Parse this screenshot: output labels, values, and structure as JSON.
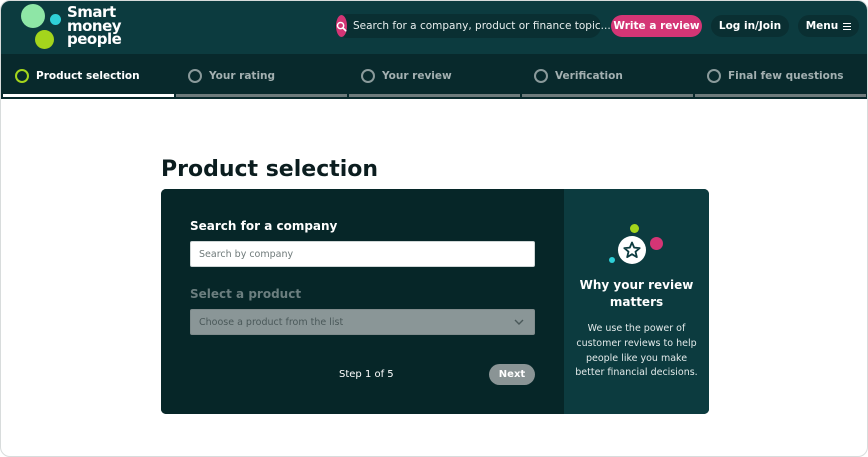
{
  "brand": {
    "logo_lines": [
      "Smart",
      "money",
      "people"
    ],
    "colors": {
      "header_bg": "#0c3b3f",
      "accent_pink": "#d43575",
      "accent_lime": "#a4d51c",
      "accent_mint": "#8ee6a6",
      "accent_cyan": "#2fd0d8",
      "card_bg": "#062628"
    }
  },
  "header": {
    "search_placeholder": "Search for a company, product or finance topic...",
    "search_icon": "search-icon",
    "write_review_label": "Write a review",
    "login_label": "Log in/Join",
    "menu_label": "Menu",
    "menu_icon": "hamburger-icon"
  },
  "steps": [
    {
      "label": "Product selection",
      "active": true
    },
    {
      "label": "Your rating",
      "active": false
    },
    {
      "label": "Your review",
      "active": false
    },
    {
      "label": "Verification",
      "active": false
    },
    {
      "label": "Final few questions",
      "active": false
    }
  ],
  "main": {
    "title": "Product selection",
    "company_label": "Search for a company",
    "company_placeholder": "Search by company",
    "product_label": "Select a product",
    "product_selected": "Choose a product from the list",
    "step_counter": "Step 1 of 5",
    "next_label": "Next"
  },
  "aside": {
    "icon": "star-badge-icon",
    "title": "Why your review matters",
    "text": "We use the power of customer reviews to help people like you make better financial decisions."
  }
}
